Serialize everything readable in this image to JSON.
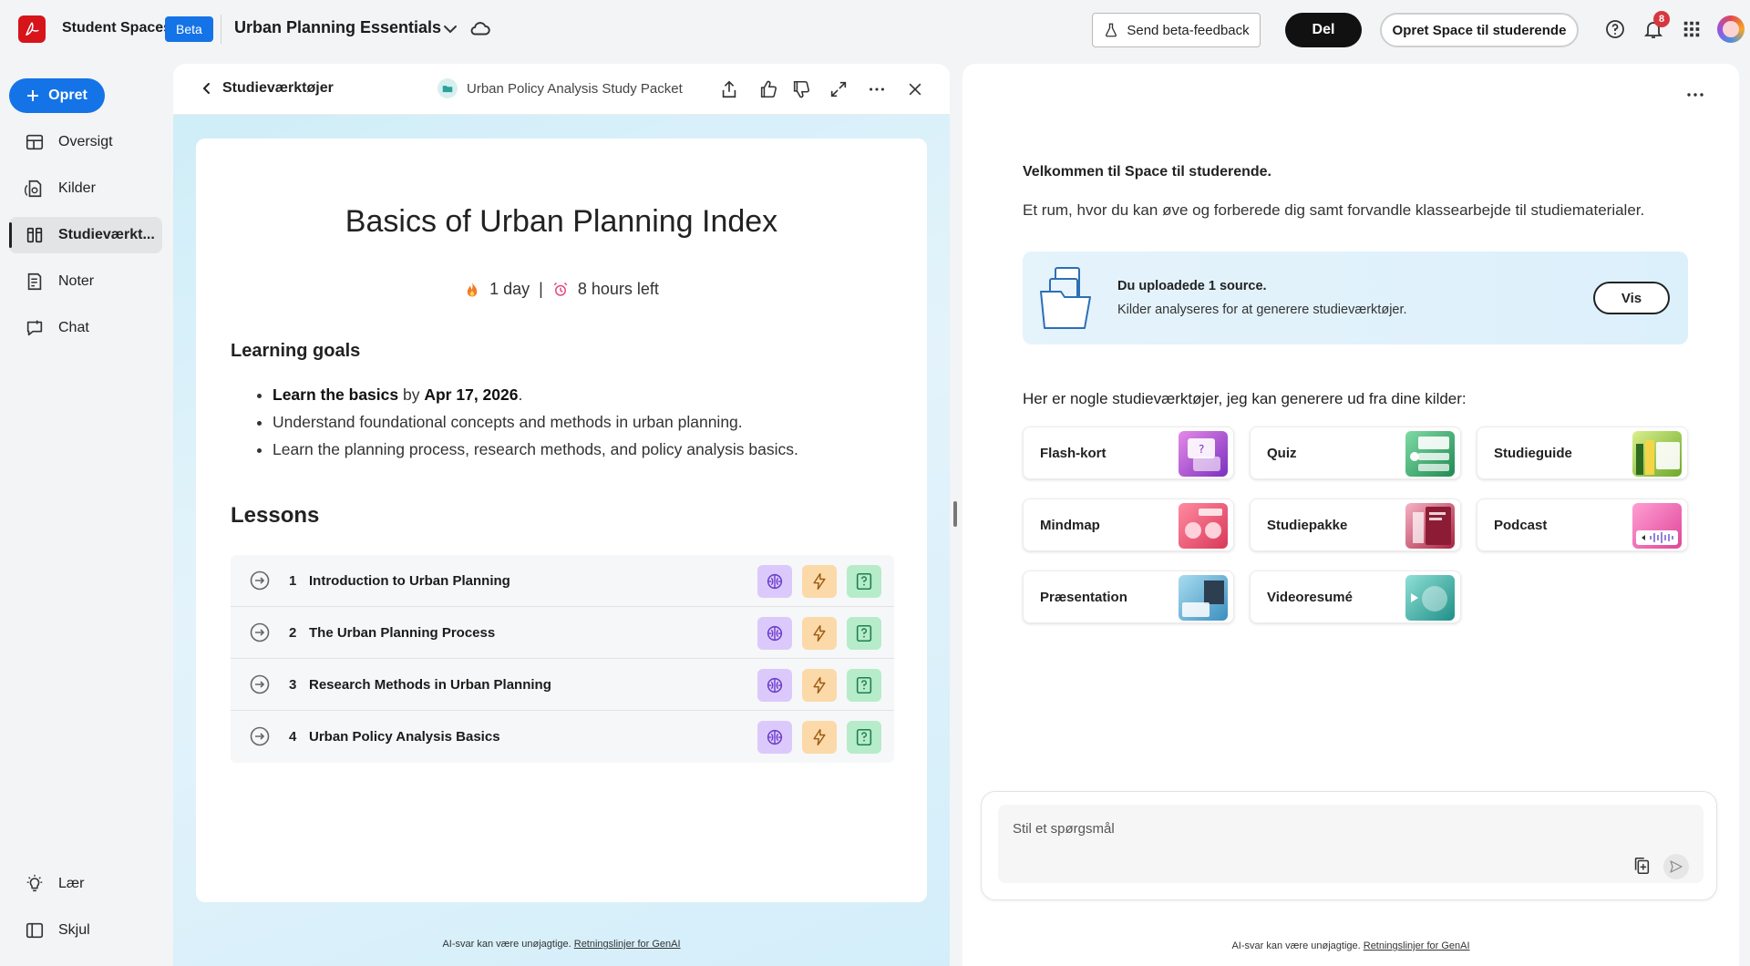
{
  "topbar": {
    "app_name": "Student Spaces",
    "beta_label": "Beta",
    "space_title": "Urban Planning Essentials",
    "feedback_label": "Send beta-feedback",
    "share_label": "Del",
    "create_space_label": "Opret Space til studerende",
    "notification_count": "8"
  },
  "nav": {
    "create_label": "Opret",
    "items": [
      {
        "label": "Oversigt",
        "icon": "overview-icon"
      },
      {
        "label": "Kilder",
        "icon": "sources-icon"
      },
      {
        "label": "Studieværkt...",
        "icon": "study-tools-icon",
        "active": true
      },
      {
        "label": "Noter",
        "icon": "notes-icon"
      },
      {
        "label": "Chat",
        "icon": "chat-icon"
      }
    ],
    "bottom": [
      {
        "label": "Lær",
        "icon": "lightbulb-icon"
      },
      {
        "label": "Skjul",
        "icon": "sidebar-collapse-icon"
      }
    ]
  },
  "study": {
    "back_label": "Studieværktøjer",
    "packet_name": "Urban Policy Analysis Study Packet",
    "title": "Basics of Urban Planning Index",
    "streak": "1 day",
    "streak_sep": "|",
    "time_left": "8 hours left",
    "goals_heading": "Learning goals",
    "goal1_strong": "Learn the basics",
    "goal1_by": "by",
    "goal1_date": "Apr 17, 2026",
    "goal1_end": ".",
    "goal2": "Understand foundational concepts and methods in urban planning.",
    "goal3": "Learn the planning process, research methods, and policy analysis basics.",
    "lessons_heading": "Lessons",
    "lessons": [
      {
        "num": "1",
        "title": "Introduction to Urban Planning"
      },
      {
        "num": "2",
        "title": "The Urban Planning Process"
      },
      {
        "num": "3",
        "title": "Research Methods in Urban Planning"
      },
      {
        "num": "4",
        "title": "Urban Policy Analysis Basics"
      }
    ],
    "disclaimer": "AI-svar kan være unøjagtige.",
    "disclaimer_link": "Retningslinjer for GenAI"
  },
  "assistant": {
    "welcome_title": "Velkommen til Space til studerende.",
    "welcome_text": "Et rum, hvor du kan øve og forberede dig samt forvandle klassearbejde til studiematerialer.",
    "upload_title": "Du uploadede 1 source.",
    "upload_text": "Kilder analyseres for at generere studieværktøjer.",
    "view_label": "Vis",
    "tools_heading": "Her er nogle studieværktøjer, jeg kan generere ud fra dine kilder:",
    "tools": [
      {
        "label": "Flash-kort",
        "color": "#b84fd6"
      },
      {
        "label": "Quiz",
        "color": "#2f9e62"
      },
      {
        "label": "Studieguide",
        "color": "#9bc53d"
      },
      {
        "label": "Mindmap",
        "color": "#e8566d"
      },
      {
        "label": "Studiepakke",
        "color": "#a7243f"
      },
      {
        "label": "Podcast",
        "color": "#e65aa8"
      },
      {
        "label": "Præsentation",
        "color": "#4aa3c9"
      },
      {
        "label": "Videoresumé",
        "color": "#2aa39b"
      }
    ],
    "input_placeholder": "Stil et spørgsmål",
    "disclaimer": "AI-svar kan være unøjagtige.",
    "disclaimer_link": "Retningslinjer for GenAI"
  }
}
